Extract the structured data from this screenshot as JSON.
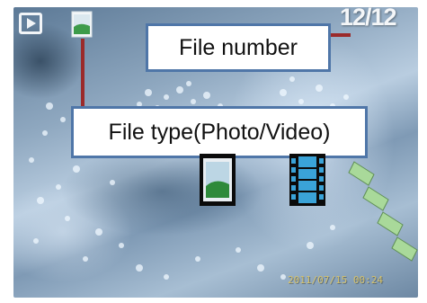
{
  "viewer": {
    "mode_icon": "play-mode-icon",
    "file_type_icon": "photo-icon",
    "file_counter": "12/12",
    "timestamp": "2011/07/15  00:24"
  },
  "callouts": {
    "file_number": "File number",
    "file_type": "File type(Photo/Video)"
  },
  "legend_icons": [
    "photo-icon",
    "video-icon"
  ],
  "colors": {
    "callout_border": "#4f76a8",
    "leader_line": "#9b2a2a",
    "photo_icon_green": "#2e8a3a",
    "video_icon_blue": "#3aa3d8"
  }
}
